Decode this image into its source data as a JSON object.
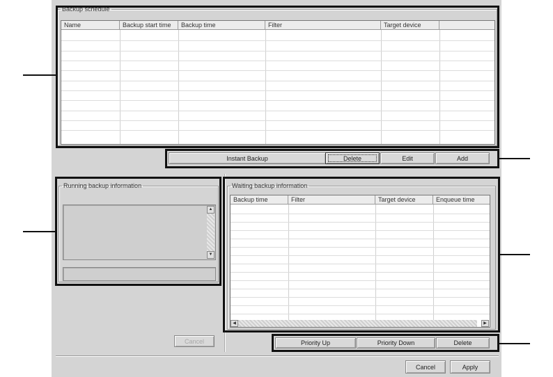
{
  "backup_schedule": {
    "title": "Backup schedule",
    "columns": [
      "Name",
      "Backup start time",
      "Backup time",
      "Filter",
      "Target device",
      ""
    ],
    "rows": []
  },
  "schedule_buttons": {
    "instant_backup": "Instant Backup",
    "delete": "Delete",
    "edit": "Edit",
    "add": "Add"
  },
  "running": {
    "title": "Running backup information",
    "cancel": "Cancel"
  },
  "waiting": {
    "title": "Waiting backup information",
    "columns": [
      "Backup time",
      "Filter",
      "Target device",
      "Enqueue time"
    ],
    "rows": []
  },
  "waiting_buttons": {
    "priority_up": "Priority Up",
    "priority_down": "Priority Down",
    "delete": "Delete"
  },
  "dialog_buttons": {
    "cancel": "Cancel",
    "apply": "Apply"
  },
  "icons": {
    "scroll_up": "▲",
    "scroll_down": "▼",
    "scroll_left": "◀",
    "scroll_right": "▶"
  }
}
